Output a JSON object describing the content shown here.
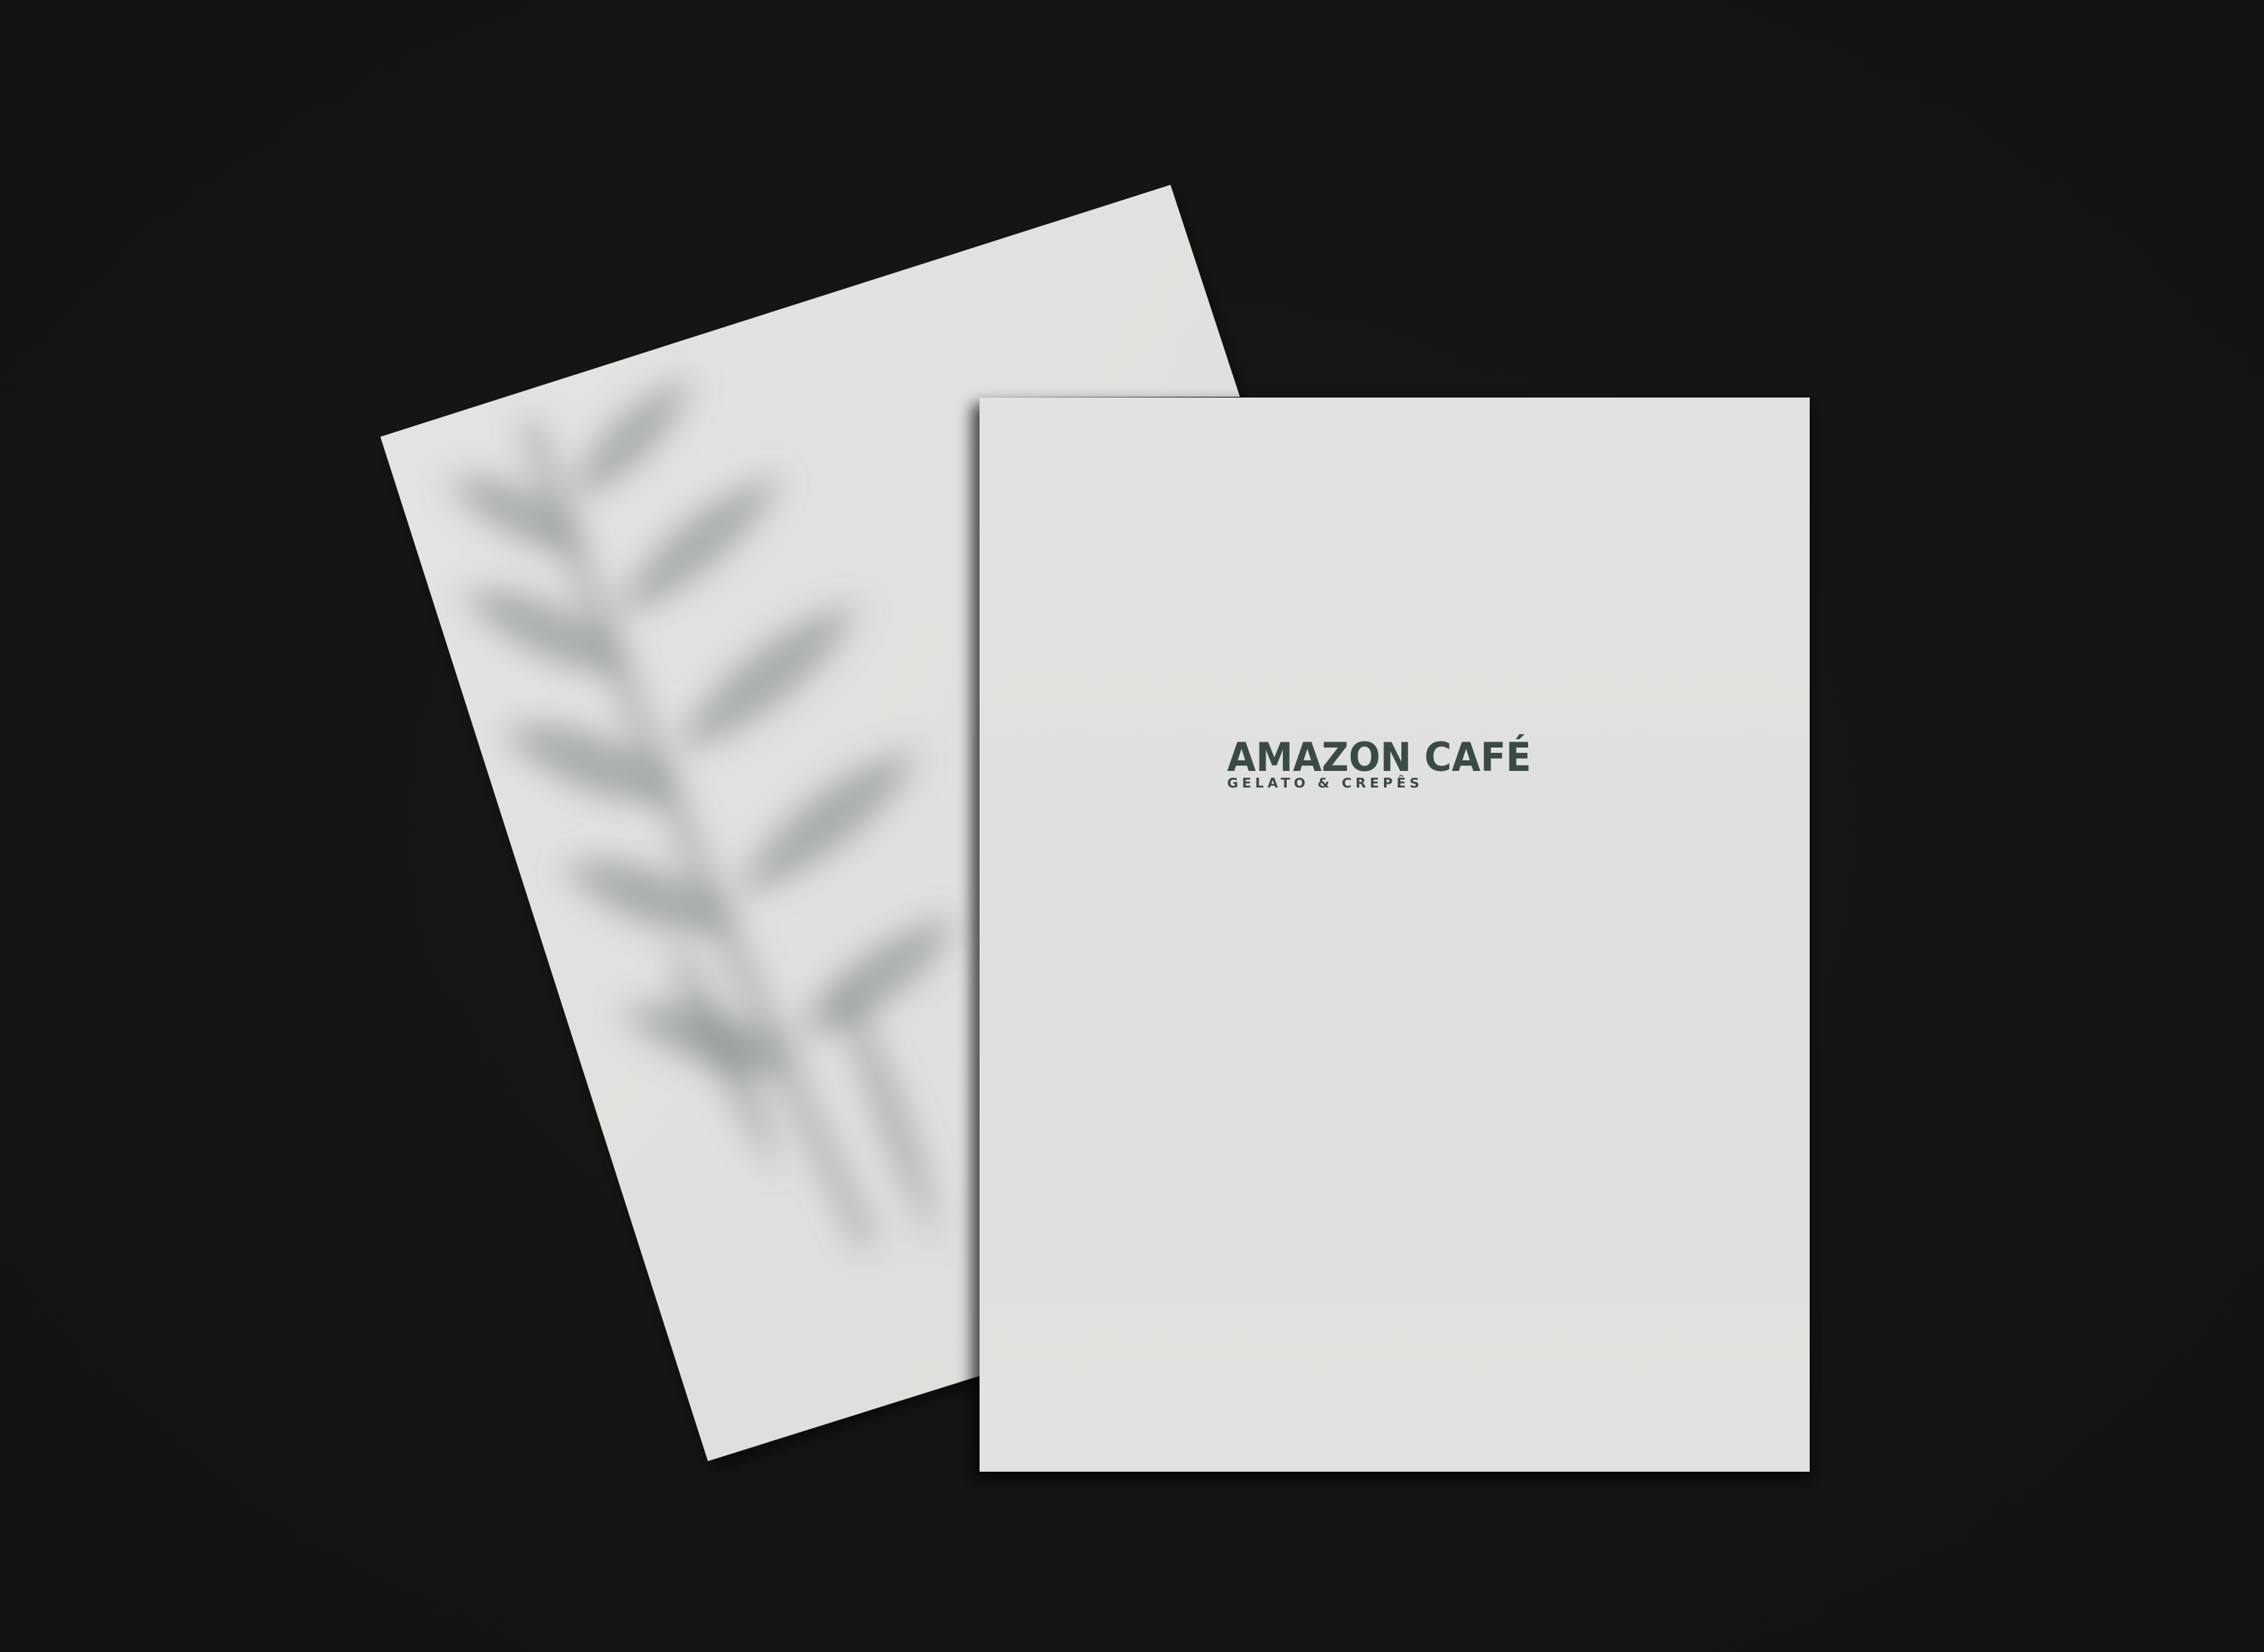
{
  "scene": {
    "background_color": "#151515",
    "paper_color": "#e1e2df",
    "shadow_motif": "palm-leaf-shadow"
  },
  "brand": {
    "name": "AMAZON CAFÉ",
    "tagline": "GELATO & CREPÊS",
    "ink_color": "#3a4a44"
  }
}
